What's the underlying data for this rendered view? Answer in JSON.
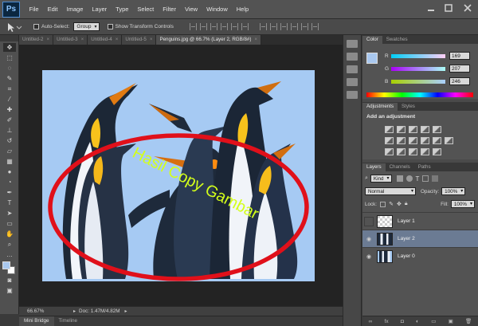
{
  "app": {
    "logo": "Ps"
  },
  "menu": [
    "File",
    "Edit",
    "Image",
    "Layer",
    "Type",
    "Select",
    "Filter",
    "View",
    "Window",
    "Help"
  ],
  "options_bar": {
    "auto_select_label": "Auto-Select:",
    "auto_select_value": "Group",
    "show_transform_label": "Show Transform Controls"
  },
  "doc_tabs": [
    {
      "label": "Untitled-2",
      "active": false
    },
    {
      "label": "Untitled-3",
      "active": false
    },
    {
      "label": "Untitled-4",
      "active": false
    },
    {
      "label": "Untitled-5",
      "active": false
    },
    {
      "label": "Penguins.jpg @ 66.7% (Layer 2, RGB/8#)",
      "active": true
    }
  ],
  "canvas": {
    "overlay_text": "Hasil Copy Gambar",
    "background_color": "#a6caf3",
    "ellipse_color": "#e0101a",
    "text_color": "#d4ff1a"
  },
  "status_bar": {
    "zoom": "66.67%",
    "doc_info": "Doc: 1.47M/4.82M"
  },
  "bottom_tabs": [
    "Mini Bridge",
    "Timeline"
  ],
  "color_panel": {
    "tabs": [
      "Color",
      "Swatches"
    ],
    "r": "169",
    "g": "207",
    "b": "246",
    "foreground": "#a9cff6"
  },
  "adjustments_panel": {
    "tabs": [
      "Adjustments",
      "Styles"
    ],
    "title": "Add an adjustment"
  },
  "layers_panel": {
    "tabs": [
      "Layers",
      "Channels",
      "Paths"
    ],
    "filter_kind": "Kind",
    "blend_mode": "Normal",
    "opacity_label": "Opacity:",
    "opacity": "100%",
    "lock_label": "Lock:",
    "fill_label": "Fill:",
    "fill": "100%",
    "layers": [
      {
        "name": "Layer 1",
        "visible": false,
        "selected": false
      },
      {
        "name": "Layer 2",
        "visible": true,
        "selected": true
      },
      {
        "name": "Layer 0",
        "visible": true,
        "selected": false
      }
    ]
  }
}
